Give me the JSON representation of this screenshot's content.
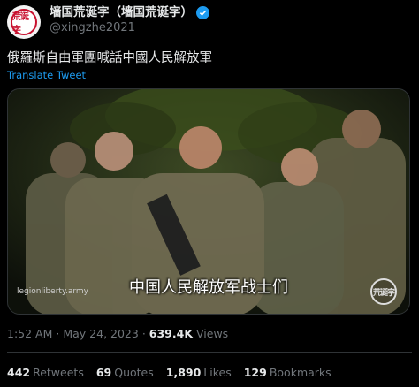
{
  "author": {
    "display_name": "墙国荒诞字（墙国荒诞字）",
    "handle": "@xingzhe2021",
    "avatar_text": "荒诞字",
    "verified": true
  },
  "tweet": {
    "text": "俄羅斯自由軍團喊話中國人民解放軍",
    "translate_label": "Translate Tweet"
  },
  "media": {
    "subtitle": "中国人民解放军战士们",
    "watermark_text": "legionliberty.army",
    "logo_text": "荒诞字"
  },
  "meta": {
    "time": "1:52 AM",
    "separator": "·",
    "date": "May 24, 2023",
    "views_count": "639.4K",
    "views_label": "Views"
  },
  "stats": {
    "retweets": {
      "count": "442",
      "label": "Retweets"
    },
    "quotes": {
      "count": "69",
      "label": "Quotes"
    },
    "likes": {
      "count": "1,890",
      "label": "Likes"
    },
    "bookmarks": {
      "count": "129",
      "label": "Bookmarks"
    }
  },
  "colors": {
    "background": "#000000",
    "text": "#e7e9ea",
    "muted": "#71767b",
    "link": "#1d9bf0",
    "brand_red": "#c8102e"
  }
}
